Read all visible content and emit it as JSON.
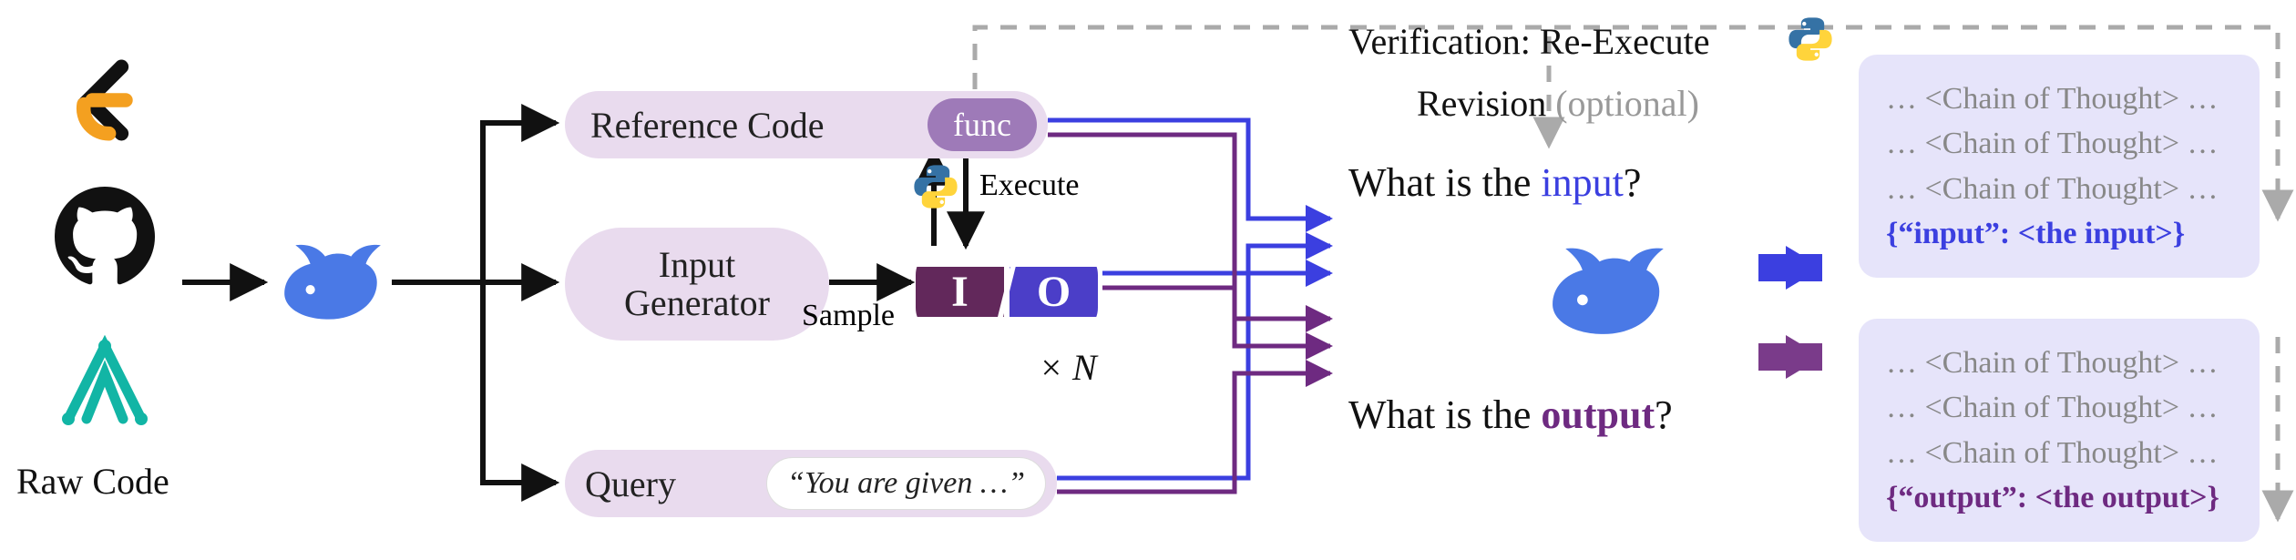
{
  "left": {
    "raw_code_label": "Raw Code"
  },
  "middle": {
    "reference_code": "Reference Code",
    "func_badge": "func",
    "input_generator": "Input Generator",
    "sample_label": "Sample",
    "execute_label": "Execute",
    "io_i": "I",
    "io_o": "O",
    "times_n": "× N",
    "query_label": "Query",
    "query_text": "“You are given …”"
  },
  "top_labels": {
    "verification": "Verification: Re-Execute",
    "revision": "Revision",
    "optional": "(optional)"
  },
  "questions": {
    "input_prefix": "What is the ",
    "input_word": "input",
    "output_prefix": "What is the ",
    "output_word": "output",
    "q_mark": "?"
  },
  "cot": {
    "line": "… <Chain of Thought> …",
    "input_json": "{“input”: <the input>}",
    "output_json": "{“output”: <the output>}"
  },
  "icons": {
    "leetcode": "leetcode-icon",
    "github": "github-icon",
    "misc_source": "ai-source-icon",
    "whale": "whale-icon",
    "python": "python-icon"
  }
}
